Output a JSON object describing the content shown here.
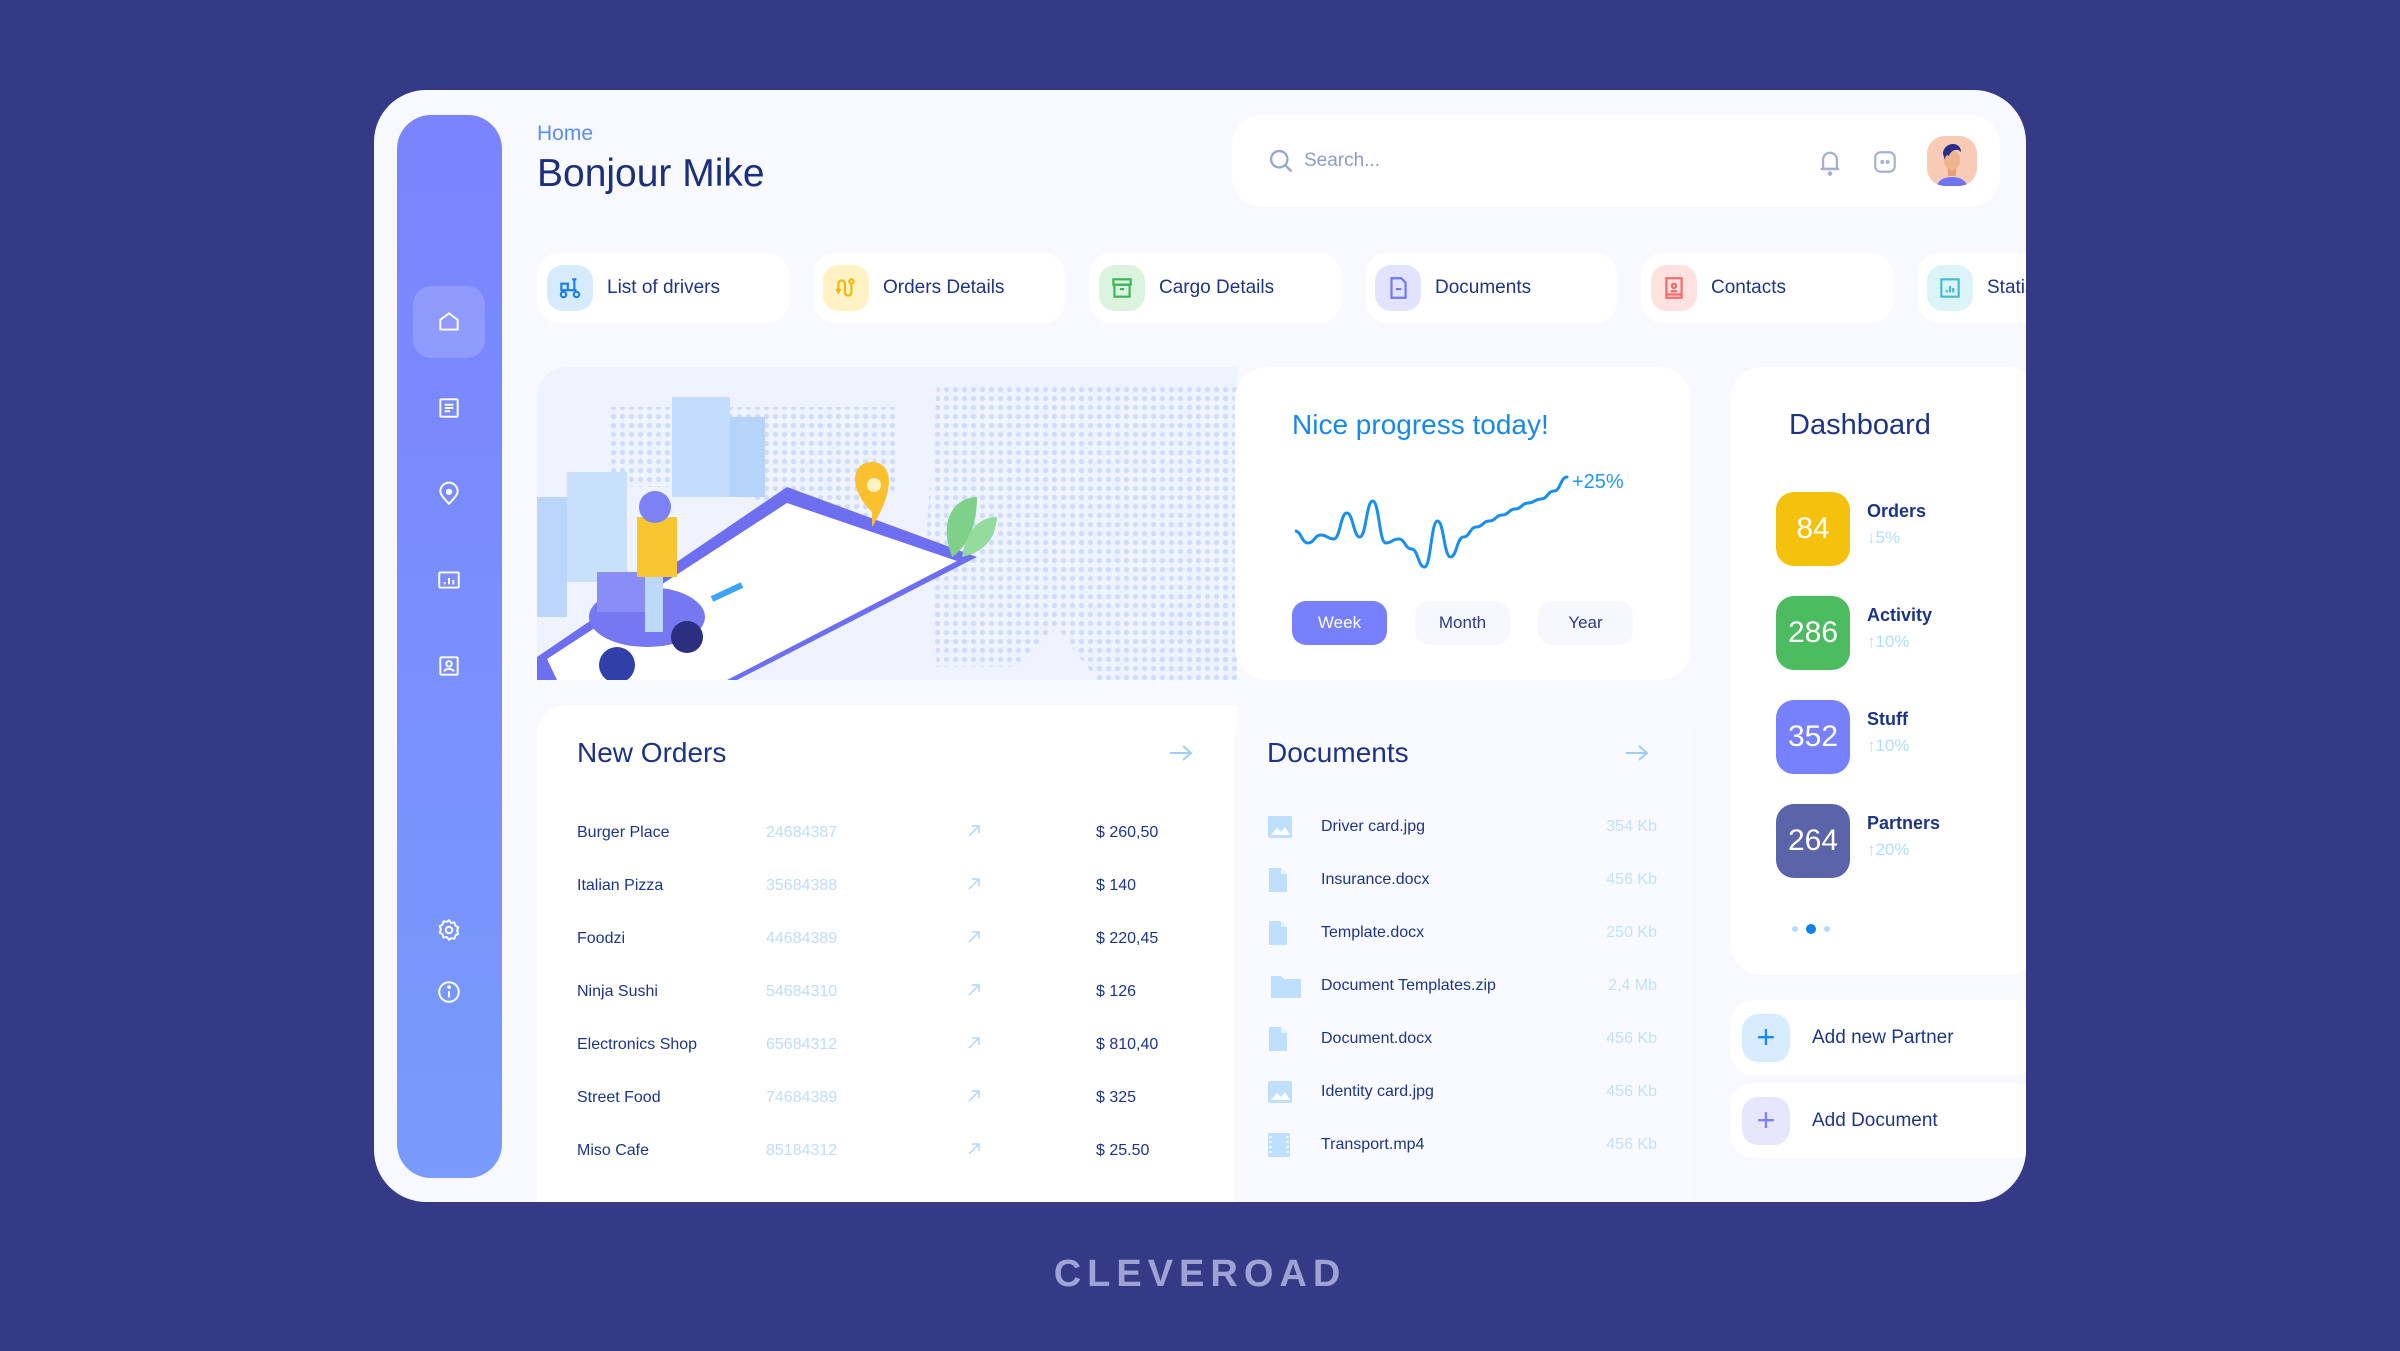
{
  "header": {
    "breadcrumb": "Home",
    "title": "Bonjour Mike",
    "search_placeholder": "Search..."
  },
  "sidebar": {
    "items": [
      {
        "name": "home",
        "icon": "home-icon",
        "active": true
      },
      {
        "name": "documents",
        "icon": "document-icon",
        "active": false
      },
      {
        "name": "location",
        "icon": "location-pin-icon",
        "active": false
      },
      {
        "name": "statistics",
        "icon": "bar-chart-icon",
        "active": false
      },
      {
        "name": "contacts",
        "icon": "contact-card-icon",
        "active": false
      }
    ],
    "bottom_items": [
      {
        "name": "settings",
        "icon": "gear-icon"
      },
      {
        "name": "info",
        "icon": "info-icon"
      }
    ]
  },
  "quick_links": [
    {
      "label": "List of drivers",
      "icon": "scooter-icon",
      "color": "#1a7ff0",
      "bg": "#d7ebff"
    },
    {
      "label": "Orders Details",
      "icon": "route-icon",
      "color": "#f2b705",
      "bg": "#fff2c4"
    },
    {
      "label": "Cargo Details",
      "icon": "archive-box-icon",
      "color": "#3cb55b",
      "bg": "#dcf3df"
    },
    {
      "label": "Documents",
      "icon": "file-icon",
      "color": "#6f78f5",
      "bg": "#e2e4ff"
    },
    {
      "label": "Contacts",
      "icon": "contact-book-icon",
      "color": "#f06a6a",
      "bg": "#ffe1df"
    },
    {
      "label": "Statistics",
      "icon": "chart-icon",
      "color": "#43bcd0",
      "bg": "#dcf3f7"
    }
  ],
  "progress": {
    "title": "Nice progress today!",
    "change_label": "+25%",
    "periods": [
      {
        "label": "Week",
        "active": true
      },
      {
        "label": "Month",
        "active": false
      },
      {
        "label": "Year",
        "active": false
      }
    ],
    "sparkline": [
      30,
      18,
      26,
      22,
      48,
      24,
      60,
      18,
      22,
      12,
      -6,
      40,
      4,
      24,
      34,
      40,
      46,
      52,
      58,
      62,
      70,
      84
    ]
  },
  "dashboard": {
    "title": "Dashboard",
    "stats": [
      {
        "value": "84",
        "label": "Orders",
        "delta": "↓5%",
        "color": "#f4c20d"
      },
      {
        "value": "286",
        "label": "Activity",
        "delta": "↑10%",
        "color": "#4dbb5f"
      },
      {
        "value": "352",
        "label": "Stuff",
        "delta": "↑10%",
        "color": "#7780fd"
      },
      {
        "value": "264",
        "label": "Partners",
        "delta": "↑20%",
        "color": "#5b63a9"
      }
    ],
    "page_dots": 3,
    "active_dot": 1
  },
  "actions": [
    {
      "label": "Add new Partner",
      "color": "#1a86f0",
      "bg": "#d8ecff"
    },
    {
      "label": "Add Document",
      "color": "#7b82f5",
      "bg": "#e6e6fd"
    }
  ],
  "new_orders": {
    "title": "New Orders",
    "rows": [
      {
        "name": "Burger Place",
        "id": "24684387",
        "price": "$ 260,50"
      },
      {
        "name": "Italian Pizza",
        "id": "35684388",
        "price": "$ 140"
      },
      {
        "name": "Foodzi",
        "id": "44684389",
        "price": "$ 220,45"
      },
      {
        "name": "Ninja Sushi",
        "id": "54684310",
        "price": "$ 126"
      },
      {
        "name": "Electronics Shop",
        "id": "65684312",
        "price": "$ 810,40"
      },
      {
        "name": "Street Food",
        "id": "74684389",
        "price": "$ 325"
      },
      {
        "name": "Miso Cafe",
        "id": "85184312",
        "price": "$ 25.50"
      }
    ]
  },
  "documents": {
    "title": "Documents",
    "rows": [
      {
        "name": "Driver card.jpg",
        "size": "354 Kb",
        "type": "image"
      },
      {
        "name": "Insurance.docx",
        "size": "456 Kb",
        "type": "file"
      },
      {
        "name": "Template.docx",
        "size": "250 Kb",
        "type": "file"
      },
      {
        "name": "Document Templates.zip",
        "size": "2,4 Mb",
        "type": "folder"
      },
      {
        "name": "Document.docx",
        "size": "456 Kb",
        "type": "file"
      },
      {
        "name": "Identity card.jpg",
        "size": "456 Kb",
        "type": "image"
      },
      {
        "name": "Transport.mp4",
        "size": "456 Kb",
        "type": "video"
      }
    ]
  },
  "brand": "CLEVEROAD"
}
